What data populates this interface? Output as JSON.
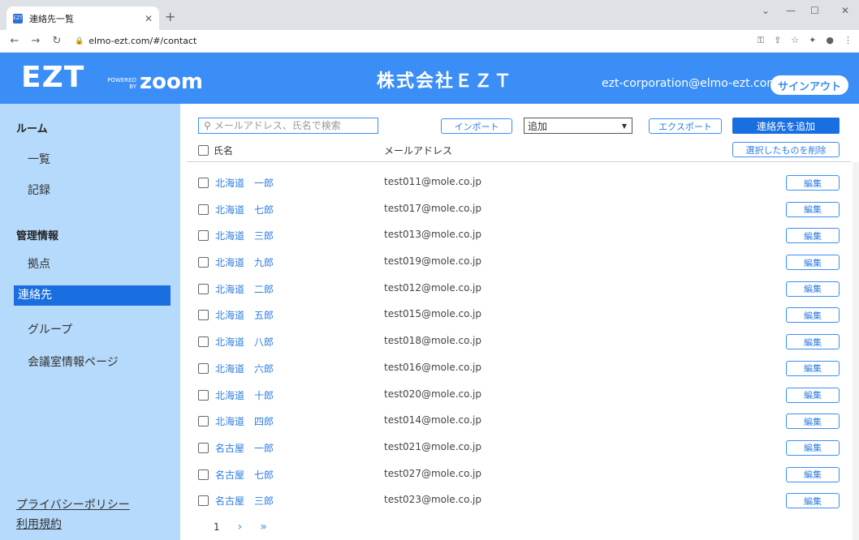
{
  "browser": {
    "tab_title": "連絡先一覧",
    "url": "elmo-ezt.com/#/contact"
  },
  "header": {
    "logo": "EZT",
    "powered_by": "POWERED BY",
    "zoom": "zoom",
    "company": "株式会社ＥＺＴ",
    "user_email": "ezt-corporation@elmo-ezt.com",
    "signout_label": "サインアウト"
  },
  "sidebar": {
    "room_heading": "ルーム",
    "room_items": [
      "一覧",
      "記録"
    ],
    "admin_heading": "管理情報",
    "admin_items": [
      "拠点",
      "連絡先",
      "グループ",
      "会議室情報ページ"
    ],
    "privacy_link": "プライバシーポリシー",
    "terms_link": "利用規約"
  },
  "toolbar": {
    "search_placeholder": "メールアドレス、氏名で検索",
    "import_label": "インポート",
    "select_value": "追加",
    "export_label": "エクスポート",
    "add_contact_label": "連絡先を追加"
  },
  "table": {
    "col_name": "氏名",
    "col_email": "メールアドレス",
    "delete_selected_label": "選択したものを削除",
    "edit_label": "編集",
    "rows": [
      {
        "name": "北海道　一郎",
        "email": "test011@mole.co.jp"
      },
      {
        "name": "北海道　七郎",
        "email": "test017@mole.co.jp"
      },
      {
        "name": "北海道　三郎",
        "email": "test013@mole.co.jp"
      },
      {
        "name": "北海道　九郎",
        "email": "test019@mole.co.jp"
      },
      {
        "name": "北海道　二郎",
        "email": "test012@mole.co.jp"
      },
      {
        "name": "北海道　五郎",
        "email": "test015@mole.co.jp"
      },
      {
        "name": "北海道　八郎",
        "email": "test018@mole.co.jp"
      },
      {
        "name": "北海道　六郎",
        "email": "test016@mole.co.jp"
      },
      {
        "name": "北海道　十郎",
        "email": "test020@mole.co.jp"
      },
      {
        "name": "北海道　四郎",
        "email": "test014@mole.co.jp"
      },
      {
        "name": "名古屋　一郎",
        "email": "test021@mole.co.jp"
      },
      {
        "name": "名古屋　七郎",
        "email": "test027@mole.co.jp"
      },
      {
        "name": "名古屋　三郎",
        "email": "test023@mole.co.jp"
      }
    ]
  },
  "pagination": {
    "current_page": "1",
    "next": "›",
    "last": "»"
  },
  "colors": {
    "header_bg": "#3a8ef6",
    "sidebar_bg": "#b5dafb",
    "active_item_bg": "#1a6fe0",
    "link": "#2f7de0"
  }
}
